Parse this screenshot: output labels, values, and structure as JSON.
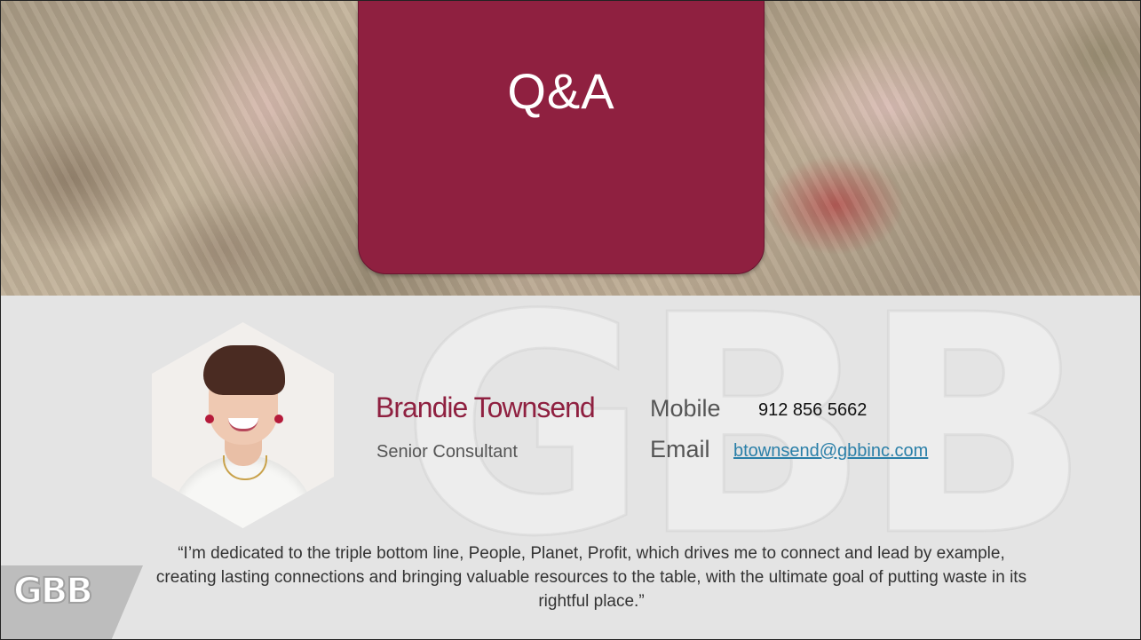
{
  "slide": {
    "title": "Q&A",
    "watermark_text": "GBB",
    "logo_text": "GBB"
  },
  "contact": {
    "name": "Brandie Townsend",
    "role": "Senior Consultant",
    "mobile_label": "Mobile",
    "mobile_value": "912 856 5662",
    "email_label": "Email",
    "email_value": "btownsend@gbbinc.com"
  },
  "quote": "“I’m dedicated to the triple bottom line, People, Planet, Profit, which drives me to connect and lead by example, creating lasting connections and bringing valuable resources to the table, with the ultimate goal of putting waste in its rightful place.”",
  "colors": {
    "accent": "#8f2040",
    "link": "#2a7fa8",
    "background": "#e4e4e4"
  }
}
